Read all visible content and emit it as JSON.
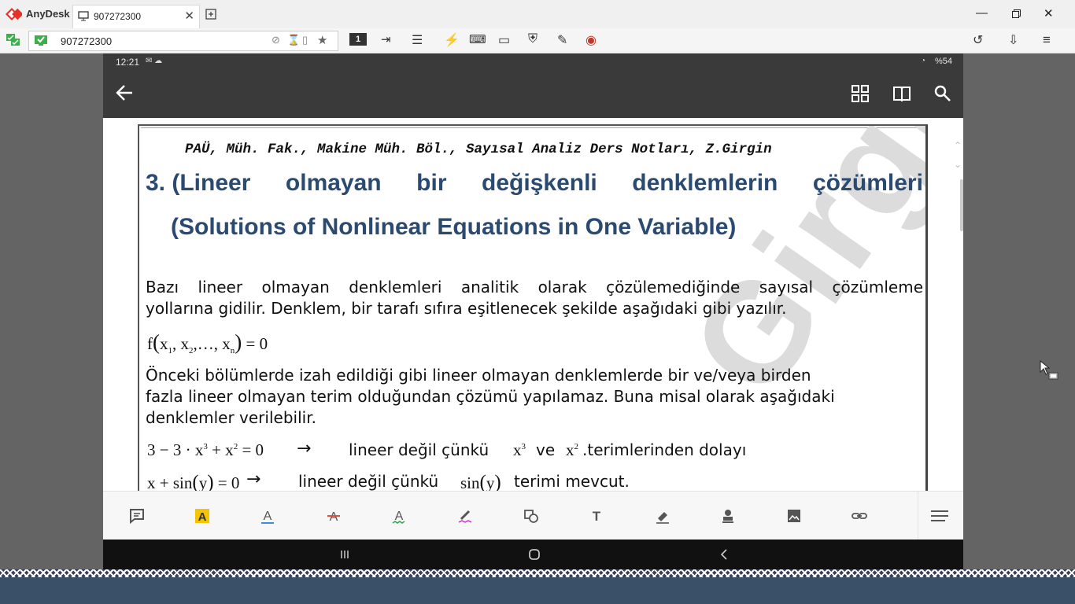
{
  "anydesk": {
    "app_name": "AnyDesk",
    "tab_label": "907272300",
    "address": "907272300",
    "monitor_number": "1"
  },
  "device": {
    "time": "12:21",
    "battery": "%54"
  },
  "document": {
    "header": "PAÜ, Müh. Fak., Makine Müh. Böl., Sayısal Analiz Ders Notları, Z.Girgin",
    "heading_tr_words": [
      "3. (Lineer",
      "olmayan",
      "bir",
      "değişkenli",
      "denklemlerin",
      "çözümleri"
    ],
    "heading_en": "(Solutions of Nonlinear Equations in One Variable)",
    "para1_line1": "Bazı lineer olmayan denklemleri analitik olarak çözülemediğinde sayısal çözümleme",
    "para1_line2": "yollarına gidilir. Denklem, bir tarafı sıfıra eşitlenecek şekilde aşağıdaki gibi yazılır.",
    "para2_line1": "Önceki bölümlerde izah edildiği gibi lineer olmayan denklemlerde bir ve/veya birden",
    "para2_line2": "fazla lineer olmayan terim olduğundan çözümü yapılamaz. Buna misal olarak aşağıdaki",
    "para2_line3": "denklemler verilebilir.",
    "ex1_text_a": "lineer değil çünkü",
    "ex1_text_b": "ve",
    "ex1_text_c": ".terimlerinden dolayı",
    "ex2_text_a": "lineer değil çünkü",
    "ex2_text_b": "terimi mevcut.",
    "watermark": "Girgin"
  },
  "colors": {
    "heading": "#2a4a72",
    "annotation_highlight": "#f5c400"
  },
  "annotation_tools": [
    "note-icon",
    "highlight-icon",
    "underline-icon",
    "strikethrough-icon",
    "squiggly-icon",
    "freehand-icon",
    "shape-icon",
    "text-icon",
    "eraser-icon",
    "stamp-icon",
    "image-icon",
    "link-icon",
    "menu-icon"
  ]
}
